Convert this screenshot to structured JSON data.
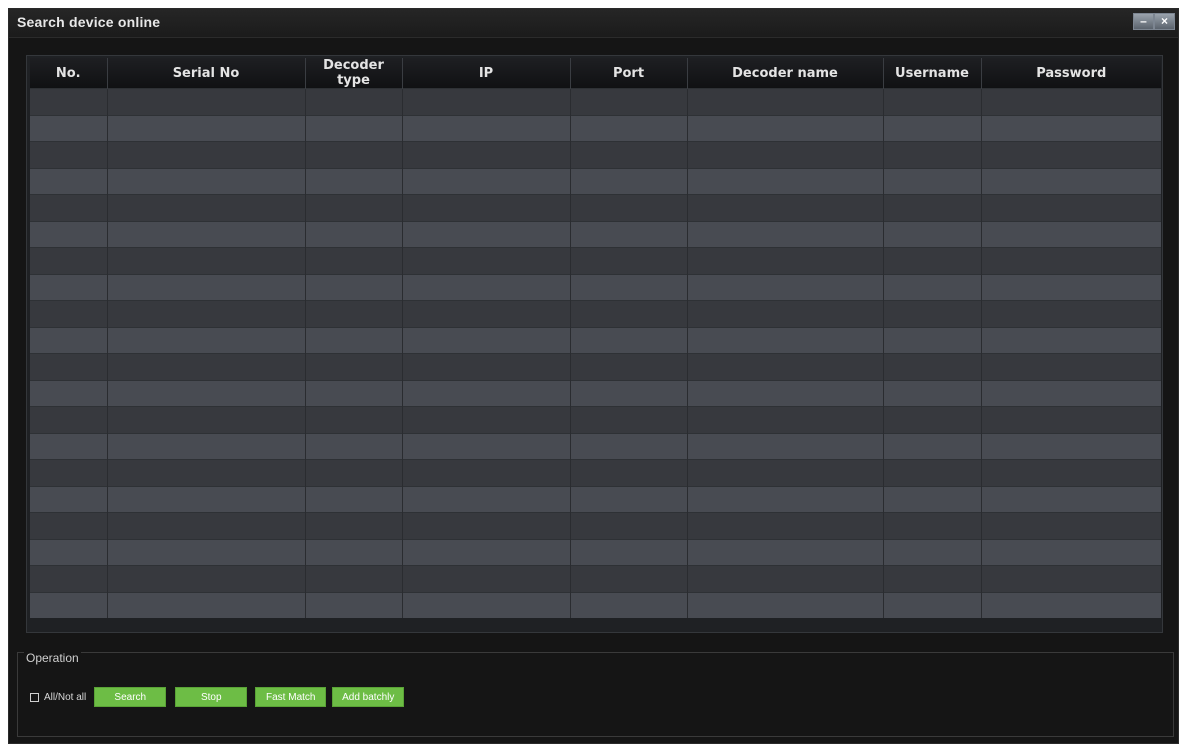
{
  "window": {
    "title": "Search device online",
    "minimize_label": "–",
    "close_label": "×"
  },
  "table": {
    "columns": [
      "No.",
      "Serial No",
      "Decoder type",
      "IP",
      "Port",
      "Decoder name",
      "Username",
      "Password"
    ],
    "rows": []
  },
  "operation": {
    "group_label": "Operation",
    "checkbox_label": "All/Not all",
    "checkbox_checked": false,
    "buttons": {
      "search": "Search",
      "stop": "Stop",
      "fast_match": "Fast Match",
      "add_batchly": "Add batchly"
    }
  },
  "colors": {
    "button_green": "#6dbd45",
    "row_dark": "#37393e",
    "row_light": "#484b52"
  }
}
